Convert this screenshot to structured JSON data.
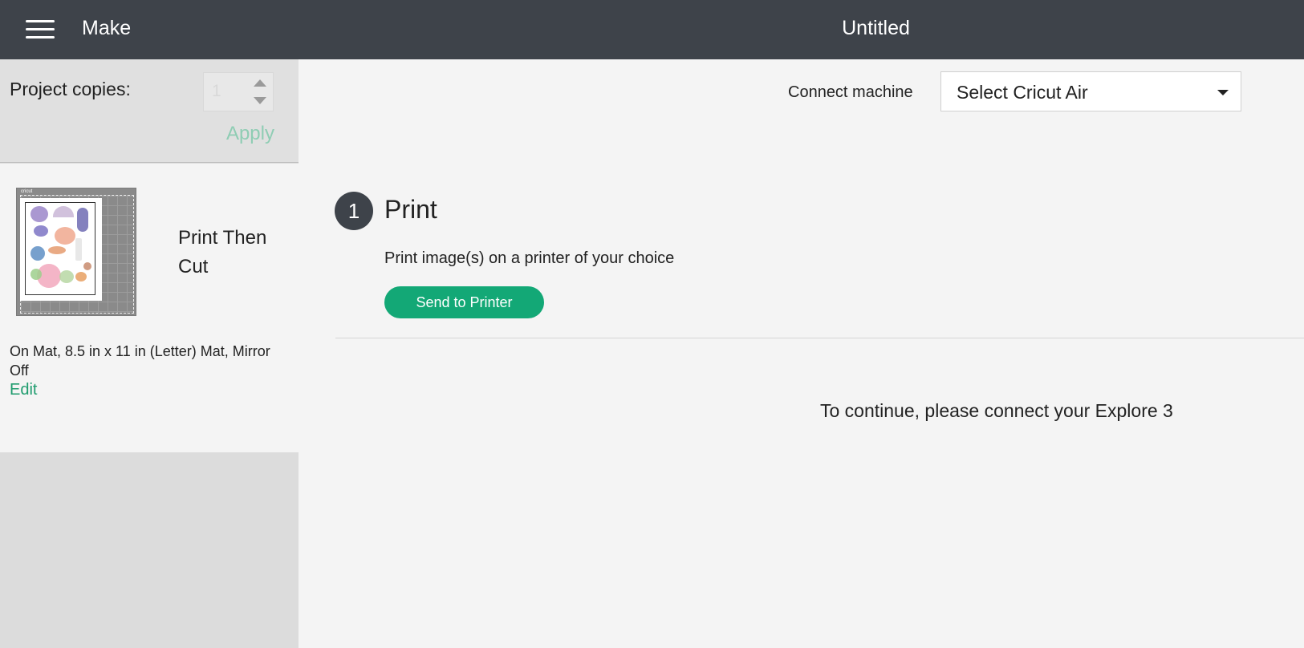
{
  "header": {
    "menu_icon": "hamburger-menu-icon",
    "app_title": "Make",
    "document_title": "Untitled",
    "background_color": "#3e434a"
  },
  "sidebar": {
    "copies": {
      "label": "Project copies:",
      "value": "1",
      "apply_label": "Apply"
    },
    "mat": {
      "name": "Print Then Cut",
      "logo_text": "cricut",
      "description": "On Mat, 8.5 in x 11 in (Letter) Mat, Mirror Off",
      "edit_label": "Edit"
    }
  },
  "main": {
    "connect_label": "Connect machine",
    "machine_select": {
      "value": "Select Cricut Air"
    },
    "step": {
      "number": "1",
      "title": "Print",
      "description": "Print image(s) on a printer of your choice",
      "button_label": "Send to Printer"
    },
    "continue_message": "To continue, please connect your Explore 3"
  },
  "colors": {
    "accent_green": "#13a876",
    "link_green": "#1f9c6e",
    "apply_disabled": "#8fcdb4"
  }
}
